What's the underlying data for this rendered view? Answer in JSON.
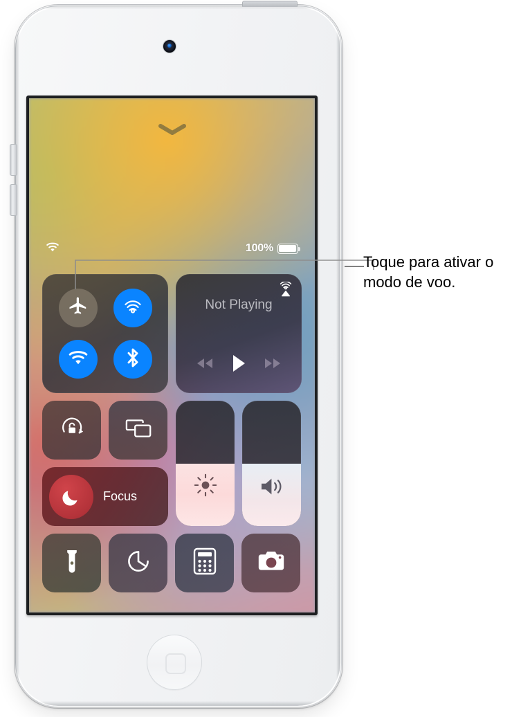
{
  "callout": {
    "text": "Toque para ativar o modo de voo.",
    "line_color": "#8c8c8c"
  },
  "device": {
    "name": "iPod touch",
    "camera_icon": "front-camera",
    "home_button_icon": "home-square",
    "power_button": "power-button",
    "volume_up_button": "volume-up-button",
    "volume_down_button": "volume-down-button"
  },
  "screen": {
    "grab_handle_icon": "chevron-down-icon",
    "status_bar": {
      "wifi_icon": "wifi-icon",
      "battery_percent": "100%",
      "battery_icon": "battery-full-icon",
      "battery_level": 100
    }
  },
  "control_center": {
    "connectivity": {
      "airplane_mode": {
        "label": "Modo de voo",
        "icon": "airplane-icon",
        "state": "off"
      },
      "airdrop": {
        "label": "AirDrop",
        "icon": "airdrop-icon",
        "state": "on"
      },
      "wifi": {
        "label": "Wi-Fi",
        "icon": "wifi-icon",
        "state": "on"
      },
      "bluetooth": {
        "label": "Bluetooth",
        "icon": "bluetooth-icon",
        "state": "on"
      },
      "colors": {
        "on": "#0a84ff",
        "off": "#8e8474"
      }
    },
    "media": {
      "title": "Not Playing",
      "airplay_icon": "airplay-audio-icon",
      "rewind_icon": "rewind-icon",
      "play_icon": "play-icon",
      "fastforward_icon": "fast-forward-icon"
    },
    "rotation_lock": {
      "icon": "rotation-lock-icon",
      "state": "off"
    },
    "screen_mirroring": {
      "icon": "screen-mirroring-icon",
      "state": "off"
    },
    "focus": {
      "label": "Focus",
      "icon": "moon-icon",
      "state": "on",
      "color": "#b4333a"
    },
    "brightness": {
      "icon": "brightness-icon",
      "value": 50
    },
    "volume": {
      "icon": "volume-icon",
      "value": 50
    },
    "flashlight": {
      "icon": "flashlight-icon",
      "state": "off"
    },
    "timer": {
      "icon": "timer-icon",
      "state": "off"
    },
    "calculator": {
      "icon": "calculator-icon",
      "state": "off"
    },
    "camera": {
      "icon": "camera-icon",
      "state": "off"
    }
  }
}
